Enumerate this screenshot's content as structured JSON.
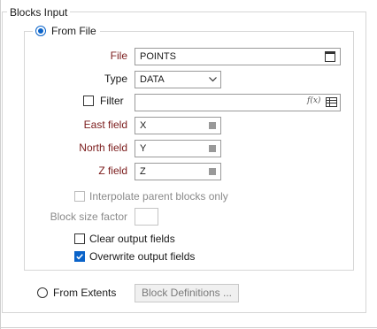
{
  "blocks_input": {
    "title": "Blocks Input",
    "from_file": {
      "label": "From File",
      "selected": true,
      "file": {
        "label": "File",
        "value": "POINTS"
      },
      "type": {
        "label": "Type",
        "value": "DATA"
      },
      "filter": {
        "label": "Filter",
        "checked": false,
        "value": "",
        "fx_label": "f(x)"
      },
      "east_field": {
        "label": "East field",
        "value": "X"
      },
      "north_field": {
        "label": "North field",
        "value": "Y"
      },
      "z_field": {
        "label": "Z field",
        "value": "Z"
      },
      "interpolate": {
        "label": "Interpolate parent blocks only",
        "checked": false,
        "enabled": false
      },
      "block_size_factor": {
        "label": "Block size factor",
        "value": ""
      },
      "clear_output": {
        "label": "Clear output fields",
        "checked": false
      },
      "overwrite_output": {
        "label": "Overwrite output fields",
        "checked": true
      }
    },
    "from_extents": {
      "label": "From Extents",
      "selected": false,
      "block_definitions_button": "Block Definitions ..."
    }
  },
  "colors": {
    "accent": "#0a63c9",
    "required_label": "#7a1a1a",
    "disabled_text": "#8a8a8a"
  }
}
